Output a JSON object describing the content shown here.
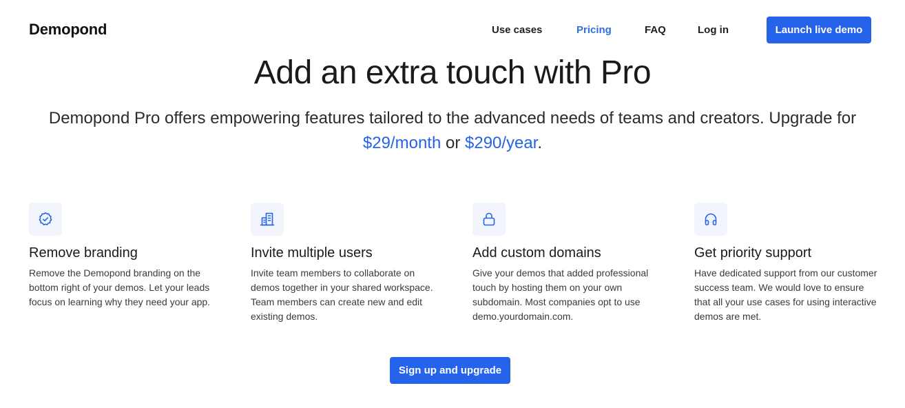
{
  "nav": {
    "logo": "Demopond",
    "links": [
      {
        "label": "Use cases"
      },
      {
        "label": "Pricing"
      },
      {
        "label": "FAQ"
      },
      {
        "label": "Log in"
      }
    ],
    "cta_label": "Launch live demo"
  },
  "hero": {
    "title": "Add an extra touch with Pro",
    "subtitle_before": "Demopond Pro offers empowering features tailored to the advanced needs of teams and creators. Upgrade for ",
    "price_month": "$29/month",
    "subtitle_or": " or ",
    "price_year": "$290/year",
    "subtitle_after": "."
  },
  "features": [
    {
      "icon": "badge-check-icon",
      "title": "Remove branding",
      "description": "Remove the Demopond branding on the bottom right of your demos. Let your leads focus on learning why they need your app."
    },
    {
      "icon": "building-icon",
      "title": "Invite multiple users",
      "description": "Invite team members to collaborate on demos together in your shared workspace. Team members can create new and edit existing demos."
    },
    {
      "icon": "lock-icon",
      "title": "Add custom domains",
      "description": "Give your demos that added professional touch by hosting them on your own subdomain. Most companies opt to use demo.yourdomain.com."
    },
    {
      "icon": "headphones-icon",
      "title": "Get priority support",
      "description": "Have dedicated support from our customer success team. We would love to ensure that all your use cases for using interactive demos are met."
    }
  ],
  "cta_label": "Sign up and upgrade",
  "colors": {
    "accent": "#2563eb",
    "active_link": "#2f6fde",
    "icon_bg": "#f2f5fb"
  }
}
